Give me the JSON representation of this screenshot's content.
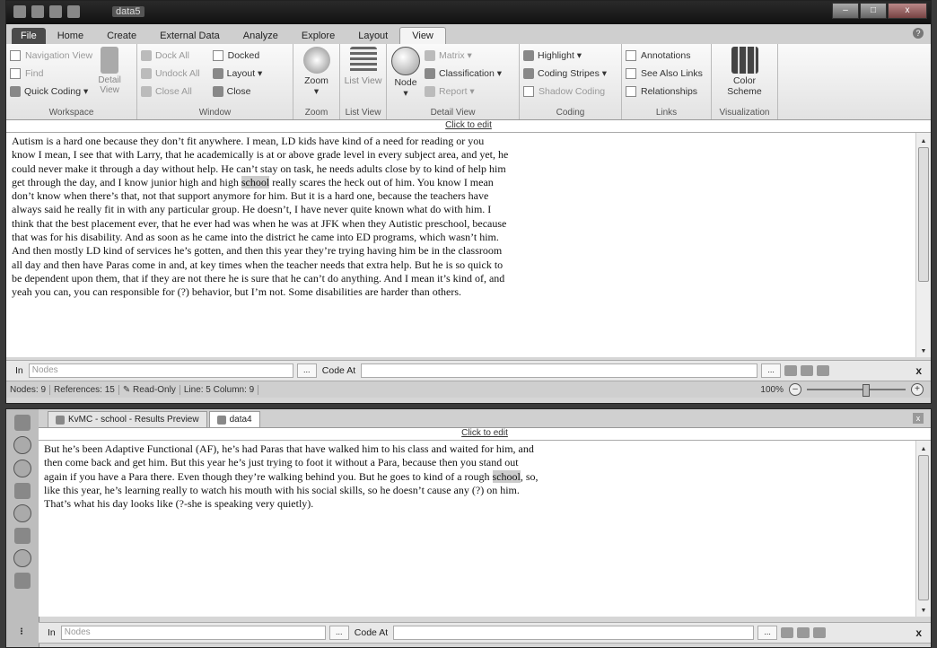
{
  "window": {
    "title": "data5"
  },
  "ribbon_tabs": [
    "File",
    "Home",
    "Create",
    "External Data",
    "Analyze",
    "Explore",
    "Layout",
    "View"
  ],
  "ribbon": {
    "workspace": {
      "label": "Workspace",
      "navigation_view": "Navigation View",
      "find": "Find",
      "quick_coding": "Quick Coding",
      "detail_view": "Detail View"
    },
    "window": {
      "label": "Window",
      "dock_all": "Dock All",
      "undock_all": "Undock All",
      "close_all": "Close All",
      "docked": "Docked",
      "layout": "Layout",
      "close": "Close"
    },
    "zoom": {
      "label": "Zoom",
      "zoom": "Zoom"
    },
    "list_view": {
      "label": "List View",
      "list_view": "List View"
    },
    "detail_view": {
      "label": "Detail View",
      "node": "Node",
      "matrix": "Matrix",
      "classification": "Classification",
      "report": "Report"
    },
    "coding": {
      "label": "Coding",
      "highlight": "Highlight",
      "coding_stripes": "Coding Stripes",
      "shadow_coding": "Shadow Coding"
    },
    "links": {
      "label": "Links",
      "annotations": "Annotations",
      "see_also_links": "See Also Links",
      "relationships": "Relationships"
    },
    "visualization": {
      "label": "Visualization",
      "color_scheme": "Color Scheme"
    }
  },
  "upper": {
    "click_to_edit": "Click to edit",
    "text_before": "Autism is a hard one because they don’t fit anywhere.  I mean, LD kids have kind of a need for reading or you know I mean, I see that with Larry, that he academically is at or above grade level in every subject area, and yet, he could never make it through a day without help.  He can’t stay on task, he needs adults close by to kind of help him get through the day, and I know junior high and high ",
    "highlight": "school",
    "text_after": " really scares the heck out of him.  You know I mean don’t know when there’s that, not that support anymore for him.  But it is a hard one, because the teachers have always said he really fit in with any particular group.  He doesn’t, I have never quite known what do with him.  I think that the best placement ever, that he ever had was when he was at JFK when they Autistic preschool, because that was for his disability.  And as soon as he came into the district he came into ED programs, which wasn’t him.  And then mostly LD kind of services he’s gotten, and then this year they’re trying having him be in the classroom all day and then have Paras come in and, at key times when the teacher needs that extra help.  But he is so quick to be dependent upon them, that if they are not there he is sure that he can’t do anything.  And I mean it’s kind of, and yeah you can, you can responsible for (?) behavior, but I’m not.  Some disabilities are harder than others.",
    "node_bar": {
      "in_label": "In",
      "in_placeholder": "Nodes",
      "dots": "...",
      "code_at": "Code At",
      "close": "x"
    },
    "status": {
      "nodes": "Nodes: 9",
      "references": "References: 15",
      "read_only": "Read-Only",
      "position": "Line: 5 Column: 9",
      "zoom": "100%"
    }
  },
  "lower": {
    "tabs": [
      "KvMC - school - Results Preview",
      "data4"
    ],
    "click_to_edit": "Click to edit",
    "text_before": "But he’s been Adaptive Functional (AF), he’s had Paras that have walked him to his class and waited for him, and then come back and get him.  But this year he’s just trying to foot it without a Para, because then you stand out again if you have a Para there.  Even though they’re walking behind you.  But he goes to kind of a rough ",
    "highlight": "school",
    "text_after": ", so, like this year, he’s learning really to watch his mouth with his social skills, so he doesn’t cause any (?)  on him.  That’s what his day looks like (?-she is speaking very quietly).",
    "node_bar": {
      "in_label": "In",
      "in_placeholder": "Nodes",
      "dots": "...",
      "code_at": "Code At",
      "close": "x"
    }
  }
}
